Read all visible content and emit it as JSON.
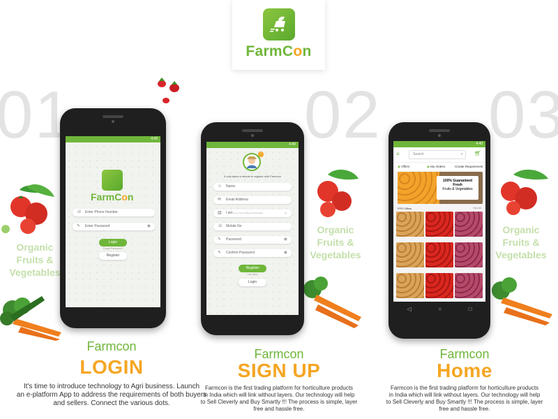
{
  "brand": {
    "name_part1": "Farm",
    "name_part2": "C",
    "name_part3": "n"
  },
  "steps": [
    {
      "number": "01",
      "name": "Farmcon",
      "title": "LOGIN",
      "desc": [
        "It's time to introduce technology to Agri business. Launch",
        "an e-platform App to address the requirements of both buyers",
        "and sellers. Connect the various dots."
      ]
    },
    {
      "number": "02",
      "name": "Farmcon",
      "title": "SIGN UP",
      "desc": [
        "Farmcon is the first trading platform for horticulture products",
        "in India which will link without layers. Our technology will help",
        "to Sell Cleverly and Buy Smartly !!! The process is simple, layer",
        "free and hassle free."
      ]
    },
    {
      "number": "03",
      "name": "Farmcon",
      "title": "Home",
      "desc": [
        "Farmcon is the first trading platform for horticulture products",
        "in India which will link without layers. Our technology will help",
        "to Sell Cleverly and Buy Smartly !!! The process is simple, layer",
        "free and hassle free."
      ]
    }
  ],
  "organic": [
    "Organic",
    "Fruits &",
    "Vegetables"
  ],
  "login": {
    "phone_placeholder": "Enter Phone Number",
    "password_placeholder": "Enter Password",
    "login_label": "Login",
    "forgot": "Forgot Password?",
    "register_label": "Register"
  },
  "signup": {
    "subtitle": "It only takes a minute to register with Farmcon",
    "fields": [
      "Name",
      "Email Address",
      "I am",
      "Mobile No",
      "Password",
      "Confirm Password"
    ],
    "role_hint": "(e.g.) Farmer/Buyer/Wholesaler",
    "register_label": "Register",
    "or_label": "I am New!",
    "login_label": "Login"
  },
  "home": {
    "search_placeholder": "Search",
    "tabs": [
      "Offers",
      "My Orders",
      "Create Requirement"
    ],
    "banner_line1": "100% Guaranteed",
    "banner_line2": "Fresh",
    "banner_line3": "Fruits & Vegetables",
    "section": "FPO Offers",
    "view_all": "View All"
  },
  "status_time": "4:40"
}
